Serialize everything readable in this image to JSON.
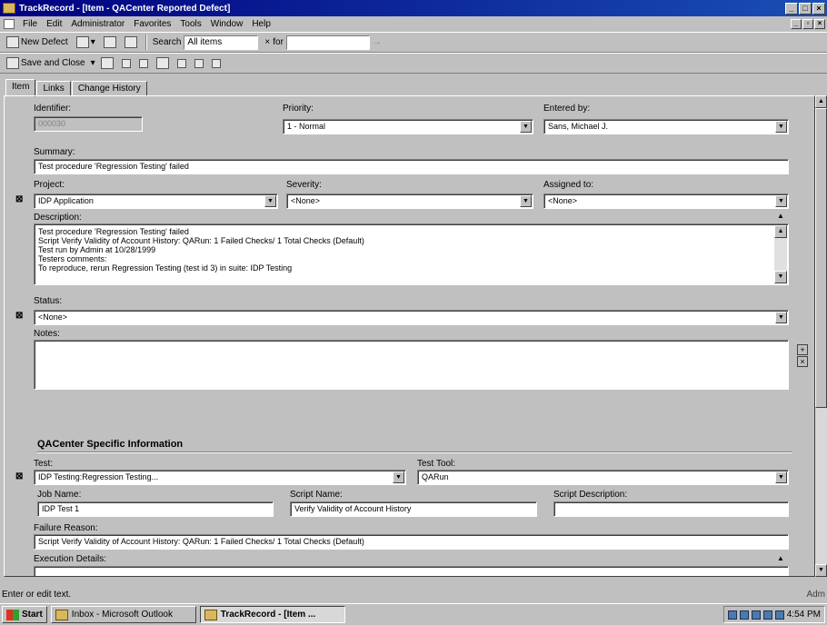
{
  "window": {
    "title": "TrackRecord - [Item - QACenter Reported Defect]"
  },
  "menu": [
    "File",
    "Edit",
    "Administrator",
    "Favorites",
    "Tools",
    "Window",
    "Help"
  ],
  "toolbar1": {
    "new_defect": "New Defect",
    "search_label": "Search",
    "search_value": "All items",
    "for_label": "for"
  },
  "toolbar2": {
    "save_close": "Save and Close"
  },
  "tabs": [
    "Item",
    "Links",
    "Change History"
  ],
  "form": {
    "identifier": {
      "label": "Identifier:",
      "value": "000030"
    },
    "priority": {
      "label": "Priority:",
      "value": "1 - Normal"
    },
    "entered_by": {
      "label": "Entered by:",
      "value": "Sans, Michael J."
    },
    "summary": {
      "label": "Summary:",
      "value": "Test procedure 'Regression Testing' failed"
    },
    "project": {
      "label": "Project:",
      "value": "IDP Application"
    },
    "severity": {
      "label": "Severity:",
      "value": "<None>"
    },
    "assigned_to": {
      "label": "Assigned to:",
      "value": "<None>"
    },
    "description": {
      "label": "Description:",
      "lines": [
        "Test procedure 'Regression Testing' failed",
        "Script Verify Validity of Account History: QARun: 1 Failed Checks/ 1 Total Checks (Default)",
        "Test run by Admin at 10/28/1999",
        "Testers comments:",
        "To reproduce, rerun Regression Testing (test id 3) in suite: IDP Testing"
      ]
    },
    "status": {
      "label": "Status:",
      "value": "<None>"
    },
    "notes": {
      "label": "Notes:",
      "value": ""
    }
  },
  "qacenter": {
    "title": "QACenter Specific Information",
    "test": {
      "label": "Test:",
      "value": "IDP Testing:Regression Testing..."
    },
    "test_tool": {
      "label": "Test Tool:",
      "value": "QARun"
    },
    "job_name": {
      "label": "Job Name:",
      "value": "IDP Test 1"
    },
    "script_name": {
      "label": "Script Name:",
      "value": "Verify Validity of Account History"
    },
    "script_description": {
      "label": "Script Description:",
      "value": ""
    },
    "failure_reason": {
      "label": "Failure Reason:",
      "value": "Script Verify Validity of Account History: QARun: 1 Failed Checks/ 1 Total Checks (Default)"
    },
    "execution_details": {
      "label": "Execution Details:"
    }
  },
  "statusbar": {
    "text": "Enter or edit text.",
    "right": "Adm"
  },
  "taskbar": {
    "start": "Start",
    "tasks": [
      "Inbox - Microsoft Outlook",
      "TrackRecord - [Item ..."
    ],
    "clock": "4:54 PM"
  }
}
